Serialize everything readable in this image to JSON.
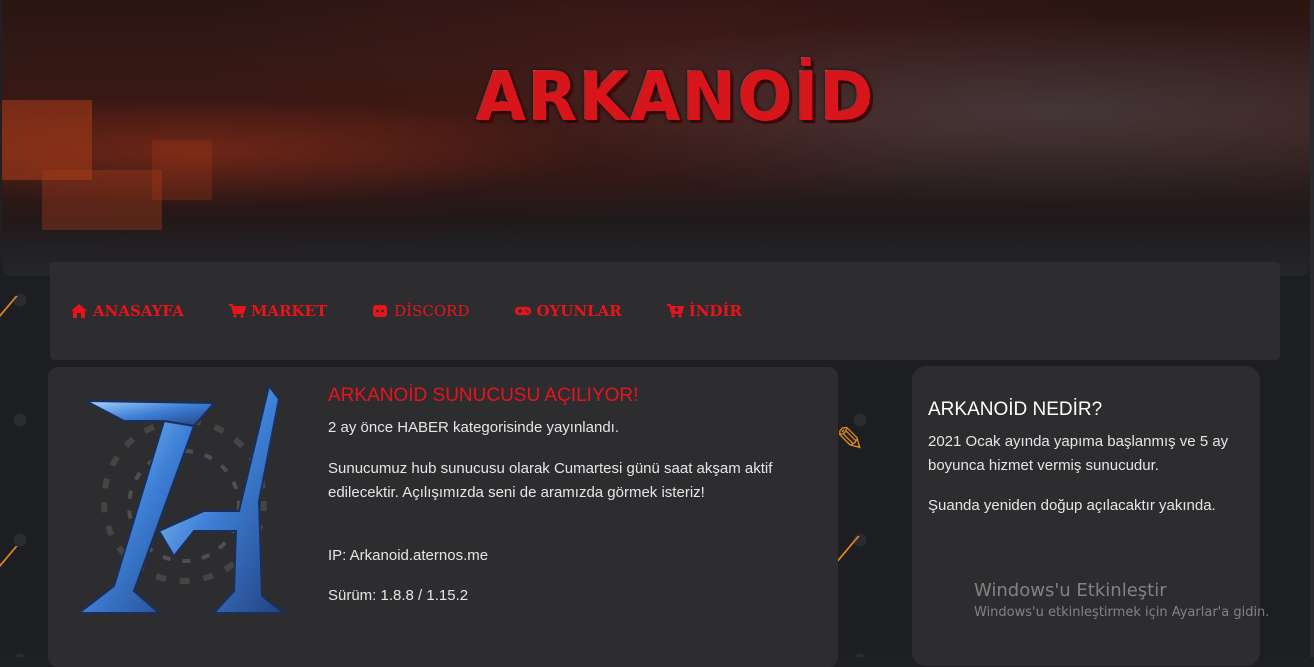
{
  "banner": {
    "logo_text": "ARKANOİD"
  },
  "nav": {
    "items": [
      {
        "label": "ANASAYFA",
        "icon": "home-icon"
      },
      {
        "label": "MARKET",
        "icon": "cart-icon"
      },
      {
        "label": "DİSCORD",
        "icon": "discord-icon"
      },
      {
        "label": "OYUNLAR",
        "icon": "gamepad-icon"
      },
      {
        "label": "İNDİR",
        "icon": "cart-download-icon"
      }
    ]
  },
  "post": {
    "title": "ARKANOİD SUNUCUSU AÇILIYOR!",
    "meta": "2 ay önce HABER kategorisinde yayınlandı.",
    "body": "Sunucumuz hub sunucusu olarak Cumartesi günü saat akşam aktif edilecektir. Açılışımızda seni de aramızda görmek isteriz!",
    "ip": "IP: Arkanoid.aternos.me",
    "version": "Sürüm: 1.8.8 / 1.15.2"
  },
  "side": {
    "title": "ARKANOİD NEDİR?",
    "p1": "2021 Ocak ayında yapıma başlanmış ve 5 ay boyunca hizmet vermiş sunucudur.",
    "p2": "Şuanda yeniden doğup açılacaktır yakında."
  },
  "watermark": {
    "title": "Windows'u Etkinleştir",
    "subtitle": "Windows'u etkinleştirmek için Ayarlar'a gidin."
  },
  "colors": {
    "accent": "#e8141c",
    "card": "#2d2d30",
    "background": "#1f2024"
  }
}
